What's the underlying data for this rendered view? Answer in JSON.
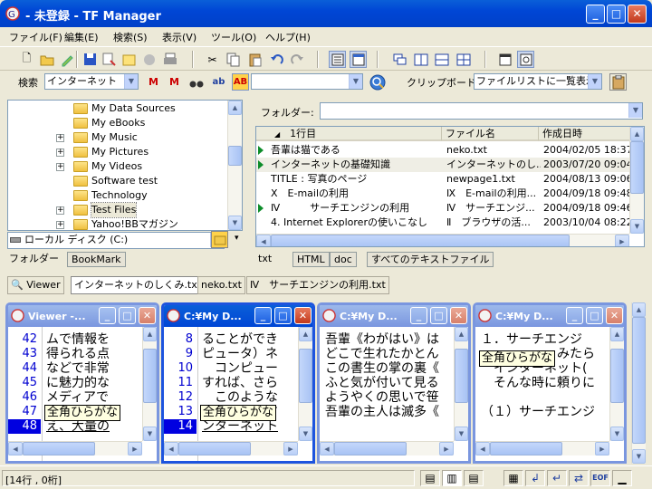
{
  "window": {
    "title": "- 未登録 - TF Manager"
  },
  "menu": [
    "ファイル(F)",
    "編集(E)",
    "検索(S)",
    "表示(V)",
    "ツール(O)",
    "ヘルプ(H)"
  ],
  "search": {
    "label": "検索",
    "engine": "インターネット",
    "query": ""
  },
  "clipboard": {
    "label": "クリップボード",
    "mode": "ファイルリストに一覧表示"
  },
  "tree": {
    "items": [
      {
        "label": "My Data Sources",
        "expander": ""
      },
      {
        "label": "My eBooks",
        "expander": ""
      },
      {
        "label": "My Music",
        "expander": "+"
      },
      {
        "label": "My Pictures",
        "expander": "+"
      },
      {
        "label": "My Videos",
        "expander": "+"
      },
      {
        "label": "Software test",
        "expander": ""
      },
      {
        "label": "Technology",
        "expander": ""
      },
      {
        "label": "Test Files",
        "expander": "+"
      },
      {
        "label": "Yahoo!BBマガジン",
        "expander": "+"
      }
    ],
    "drive": "ローカル ディスク (C:)"
  },
  "left_tabs": [
    "フォルダー",
    "BookMark"
  ],
  "folder": {
    "label": "フォルダー:",
    "value": ""
  },
  "filelist": {
    "headers": [
      "1行目",
      "ファイル名",
      "作成日時"
    ],
    "rows": [
      {
        "first": "吾輩は猫である",
        "file": "neko.txt",
        "date": "2004/02/05 18:37",
        "mark": true
      },
      {
        "first": "インターネットの基礎知識",
        "file": "インターネットのし...",
        "date": "2003/07/20 09:04",
        "mark": true
      },
      {
        "first": "TITLE : 写真のページ",
        "file": "newpage1.txt",
        "date": "2004/08/13 09:06",
        "mark": false
      },
      {
        "first": "Ⅹ　E-mailの利用",
        "file": "Ⅸ　E-mailの利用...",
        "date": "2004/09/18 09:48",
        "mark": false
      },
      {
        "first": "Ⅳ　　　サーチエンジンの利用",
        "file": "Ⅳ　サーチエンジ...",
        "date": "2004/09/18 09:46",
        "mark": true
      },
      {
        "first": "4. Internet Explorerの使いこなし",
        "file": "Ⅱ　ブラウザの活...",
        "date": "2003/10/04 08:22",
        "mark": false
      }
    ]
  },
  "file_tabs": [
    "txt",
    "HTML",
    "doc",
    "すべてのテキストファイル"
  ],
  "viewer_tabs": [
    "Viewer",
    "インターネットのしくみ.txt",
    "neko.txt",
    "Ⅳ　サーチエンジンの利用.txt"
  ],
  "children": [
    {
      "title": "Viewer -...",
      "lines": [
        {
          "n": "42",
          "t": "ムで情報を"
        },
        {
          "n": "43",
          "t": "得られる点"
        },
        {
          "n": "44",
          "t": "などで非常"
        },
        {
          "n": "45",
          "t": "に魅力的な"
        },
        {
          "n": "46",
          "t": "メディアで"
        },
        {
          "n": "47",
          "t": "あると"
        },
        {
          "n": "48",
          "t": "え、大量の"
        }
      ],
      "tip": "全角ひらがな"
    },
    {
      "title": "C:¥My D...",
      "lines": [
        {
          "n": "8",
          "t": "ることができ"
        },
        {
          "n": "9",
          "t": "ピュータ）ネ"
        },
        {
          "n": "10",
          "t": "　コンピュー"
        },
        {
          "n": "11",
          "t": "すれば、さら"
        },
        {
          "n": "12",
          "t": "　このような"
        },
        {
          "n": "13",
          "t": "　　　　　す"
        },
        {
          "n": "14",
          "t": "ンターネット"
        }
      ],
      "tip": "全角ひらがな"
    },
    {
      "title": "C:¥My D...",
      "lines": [
        {
          "t": "吾輩《わがはい》は"
        },
        {
          "t": "どこで生れたかとん"
        },
        {
          "t": "この書生の掌の裏《"
        },
        {
          "t": "ふと気が付いて見る"
        },
        {
          "t": "ようやくの思いで笹"
        },
        {
          "t": "吾輩の主人は滅多《"
        }
      ]
    },
    {
      "title": "C:¥My D...",
      "lines": [
        {
          "t": "１．サーチエンジ"
        },
        {
          "t": "　　　　　　みたら"
        },
        {
          "t": "　インターネット("
        },
        {
          "t": "　そんな時に頼りに"
        },
        {
          "t": ""
        },
        {
          "t": "（１）サーチエンジ"
        }
      ],
      "tip": "全角ひらがな"
    }
  ],
  "status": {
    "position": "[14行 , 0桁]",
    "eof": "EOF"
  }
}
